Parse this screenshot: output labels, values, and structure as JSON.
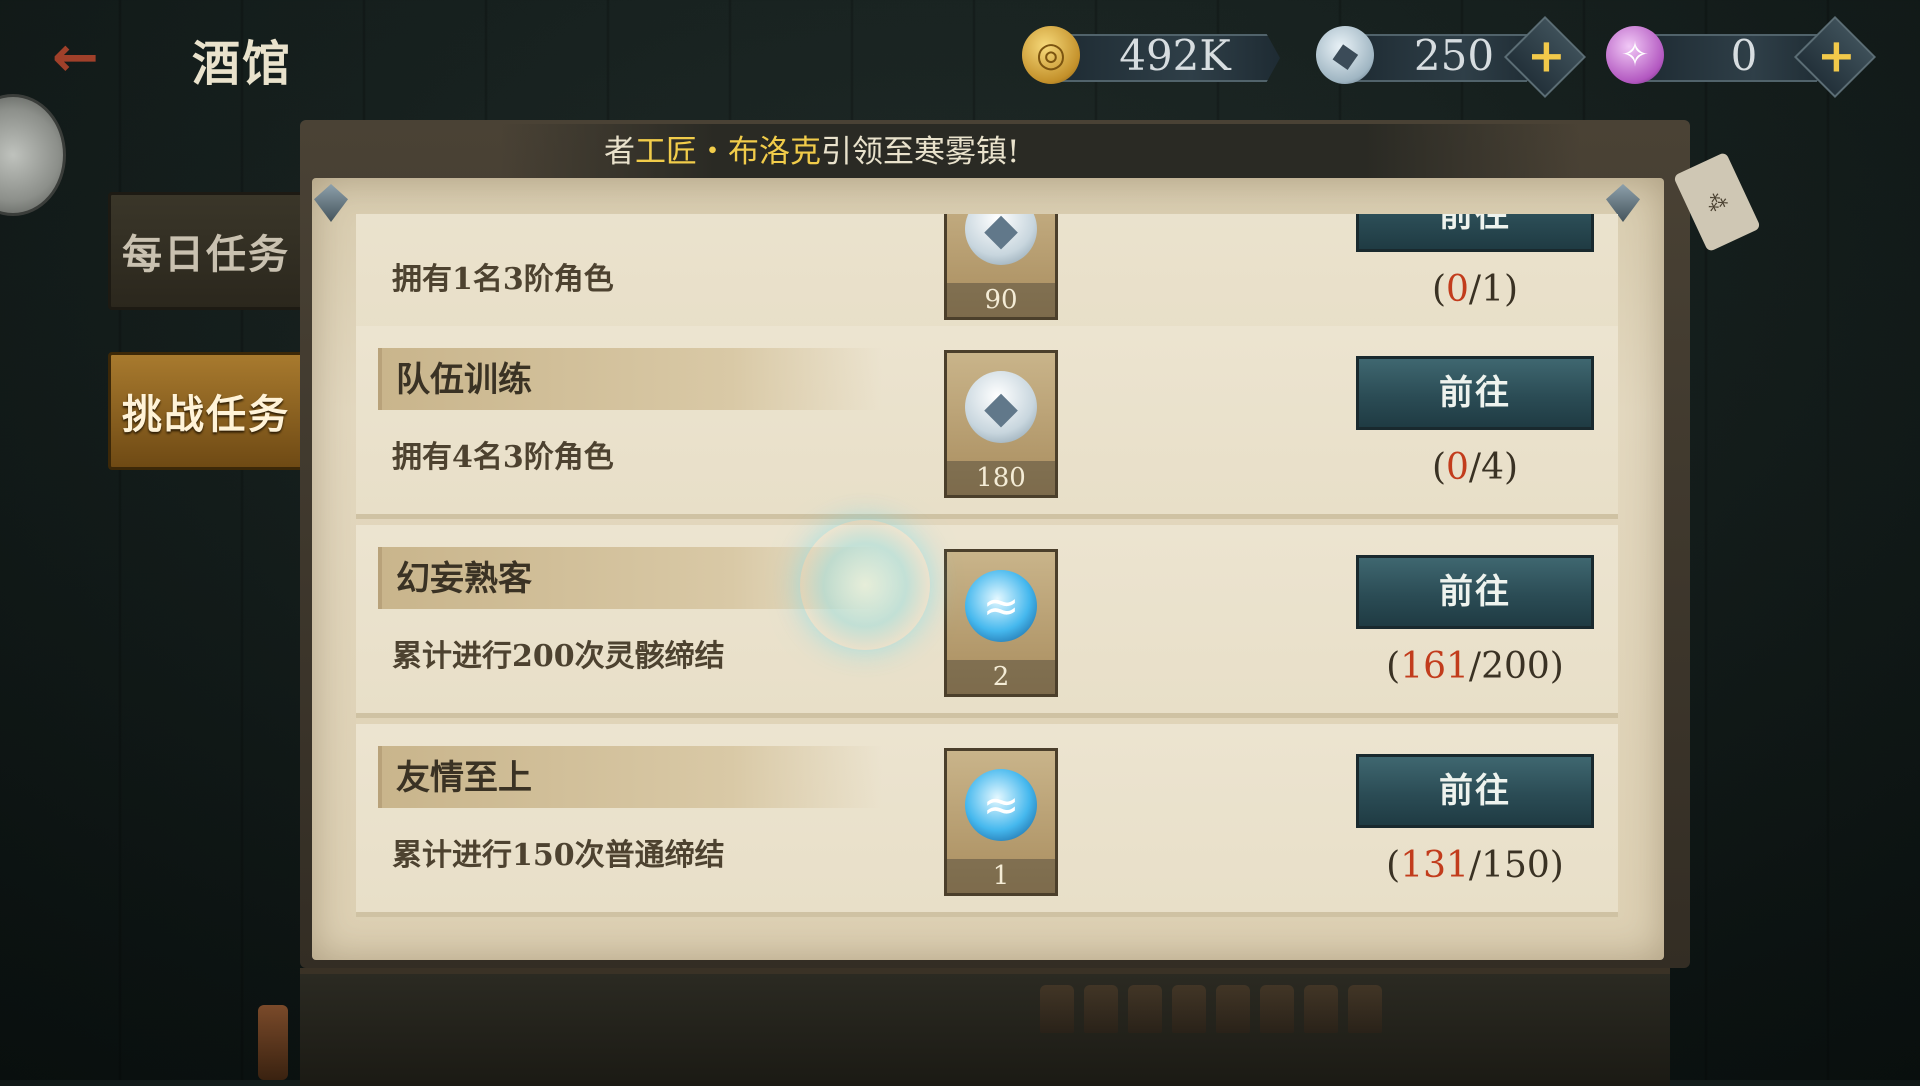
{
  "header": {
    "back_icon": "back-arrow-icon",
    "title": "酒馆"
  },
  "currencies": [
    {
      "icon": "gold-coin-icon",
      "value": "492K",
      "has_plus": false
    },
    {
      "icon": "diamond-icon",
      "value": "250",
      "has_plus": true
    },
    {
      "icon": "purple-crystal-icon",
      "value": "0",
      "has_plus": true
    }
  ],
  "banner": {
    "prefix": "者",
    "highlight": "工匠・布洛克",
    "suffix": "引领至寒雾镇!"
  },
  "tabs": [
    {
      "label": "每日任务",
      "active": false
    },
    {
      "label": "挑战任务",
      "active": true
    }
  ],
  "tasks": [
    {
      "title": "",
      "desc": "拥有1名3阶角色",
      "reward_icon": "diamond-icon",
      "reward_count": "90",
      "button": "前往",
      "progress_current": "0",
      "progress_total": "1"
    },
    {
      "title": "队伍训练",
      "desc": "拥有4名3阶角色",
      "reward_icon": "diamond-icon",
      "reward_count": "180",
      "button": "前往",
      "progress_current": "0",
      "progress_total": "4"
    },
    {
      "title": "幻妄熟客",
      "desc": "累计进行200次灵骸缔结",
      "reward_icon": "blue-swirl-icon",
      "reward_count": "2",
      "button": "前往",
      "progress_current": "161",
      "progress_total": "200"
    },
    {
      "title": "友情至上",
      "desc": "累计进行150次普通缔结",
      "reward_icon": "blue-swirl-icon",
      "reward_count": "1",
      "button": "前往",
      "progress_current": "131",
      "progress_total": "150"
    }
  ],
  "colors": {
    "progress_current": "#c23c1c",
    "banner_highlight": "#f1cc4a",
    "button_bg": "#2b4c55"
  }
}
